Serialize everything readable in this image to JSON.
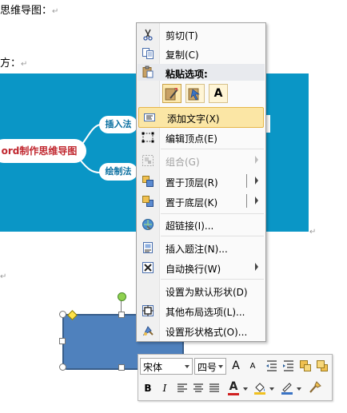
{
  "document": {
    "heading": "思维导图：",
    "line2": "方：",
    "para_mark": "↵"
  },
  "mindmap": {
    "center": "ord制作思维导图",
    "branch1": "插入法",
    "branch2": "绘制法"
  },
  "context_menu": {
    "items": [
      {
        "label": "剪切(T)",
        "icon": "scissors-icon"
      },
      {
        "label": "复制(C)",
        "icon": "copy-icon"
      },
      {
        "label": "粘贴选项:",
        "icon": "paste-icon"
      },
      {
        "label": "添加文字(X)",
        "icon": "textbox-icon"
      },
      {
        "label": "编辑顶点(E)",
        "icon": "edit-points-icon"
      },
      {
        "label": "组合(G)",
        "icon": "group-icon"
      },
      {
        "label": "置于顶层(R)",
        "icon": "bring-to-front-icon"
      },
      {
        "label": "置于底层(K)",
        "icon": "send-to-back-icon"
      },
      {
        "label": "超链接(I)...",
        "icon": "hyperlink-icon"
      },
      {
        "label": "插入题注(N)...",
        "icon": "caption-icon"
      },
      {
        "label": "自动换行(W)",
        "icon": "wrap-text-icon"
      },
      {
        "label": "设置为默认形状(D)",
        "icon": ""
      },
      {
        "label": "其他布局选项(L)...",
        "icon": "layout-icon"
      },
      {
        "label": "设置形状格式(O)...",
        "icon": "format-shape-icon"
      }
    ],
    "paste_buttons": [
      "paste-keep-format-icon",
      "paste-picture-icon",
      "A"
    ]
  },
  "mini_toolbar": {
    "font": "宋体",
    "size": "四号",
    "grow": "A",
    "shrink": "A",
    "bold": "B",
    "italic": "I",
    "font_color_letter": "A"
  }
}
